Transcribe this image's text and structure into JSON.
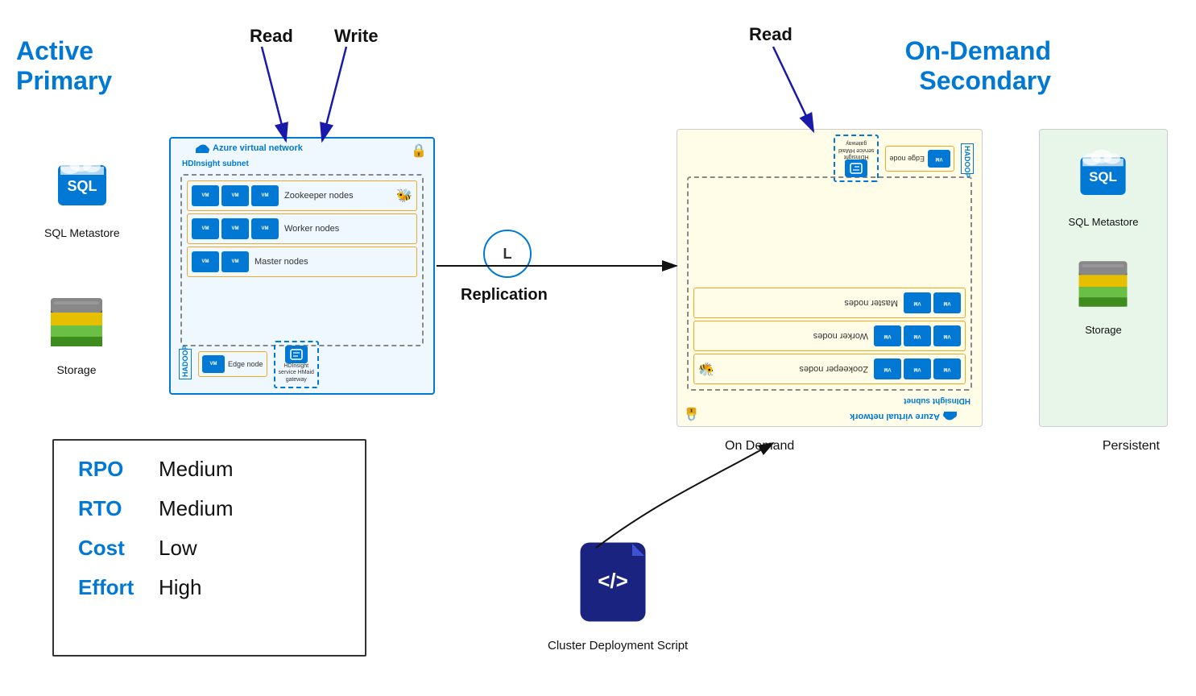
{
  "labels": {
    "active_primary_line1": "Active",
    "active_primary_line2": "Primary",
    "on_demand_secondary_line1": "On-Demand",
    "on_demand_secondary_line2": "Secondary",
    "read": "Read",
    "write": "Write",
    "read_right": "Read",
    "replication_icon": "L",
    "replication": "Replication",
    "sql_metastore": "SQL Metastore",
    "storage": "Storage",
    "on_demand": "On Demand",
    "persistent": "Persistent",
    "cluster_deployment_script": "Cluster Deployment Script",
    "azure_virtual_network": "Azure virtual network",
    "hdinsight_subnet": "HDInsight subnet",
    "zookeeper_nodes": "Zookeeper nodes",
    "worker_nodes": "Worker nodes",
    "master_nodes": "Master nodes",
    "edge_node": "Edge node",
    "hdinsight_service_hmaid_gateway": "HDInsight service HMaid gateway"
  },
  "metrics": [
    {
      "key": "RPO",
      "value": "Medium"
    },
    {
      "key": "RTO",
      "value": "Medium"
    },
    {
      "key": "Cost",
      "value": "Low"
    },
    {
      "key": "Effort",
      "value": "High"
    }
  ],
  "colors": {
    "blue": "#0078d4",
    "light_blue_bg": "#f0f8ff",
    "yellow_bg": "#fffde7",
    "green_bg": "#e8f5e9",
    "arrow": "#1a1aaa"
  }
}
